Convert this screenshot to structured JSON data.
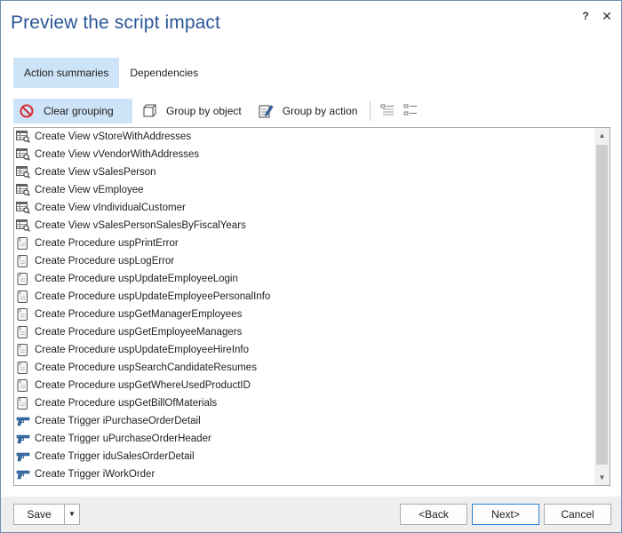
{
  "window": {
    "title": "Preview the script impact",
    "help": "?",
    "close": "✕"
  },
  "tabs": [
    {
      "label": "Action summaries",
      "active": true
    },
    {
      "label": "Dependencies",
      "active": false
    }
  ],
  "toolbar": {
    "clear_grouping": "Clear grouping",
    "group_by_object": "Group by object",
    "group_by_action": "Group by action"
  },
  "items": [
    {
      "type": "view",
      "text": "Create View vStoreWithAddresses"
    },
    {
      "type": "view",
      "text": "Create View vVendorWithAddresses"
    },
    {
      "type": "view",
      "text": "Create View vSalesPerson"
    },
    {
      "type": "view",
      "text": "Create View vEmployee"
    },
    {
      "type": "view",
      "text": "Create View vIndividualCustomer"
    },
    {
      "type": "view",
      "text": "Create View vSalesPersonSalesByFiscalYears"
    },
    {
      "type": "procedure",
      "text": "Create Procedure uspPrintError"
    },
    {
      "type": "procedure",
      "text": "Create Procedure uspLogError"
    },
    {
      "type": "procedure",
      "text": "Create Procedure uspUpdateEmployeeLogin"
    },
    {
      "type": "procedure",
      "text": "Create Procedure uspUpdateEmployeePersonalInfo"
    },
    {
      "type": "procedure",
      "text": "Create Procedure uspGetManagerEmployees"
    },
    {
      "type": "procedure",
      "text": "Create Procedure uspGetEmployeeManagers"
    },
    {
      "type": "procedure",
      "text": "Create Procedure uspUpdateEmployeeHireInfo"
    },
    {
      "type": "procedure",
      "text": "Create Procedure uspSearchCandidateResumes"
    },
    {
      "type": "procedure",
      "text": "Create Procedure uspGetWhereUsedProductID"
    },
    {
      "type": "procedure",
      "text": "Create Procedure uspGetBillOfMaterials"
    },
    {
      "type": "trigger",
      "text": "Create Trigger iPurchaseOrderDetail"
    },
    {
      "type": "trigger",
      "text": "Create Trigger uPurchaseOrderHeader"
    },
    {
      "type": "trigger",
      "text": "Create Trigger iduSalesOrderDetail"
    },
    {
      "type": "trigger",
      "text": "Create Trigger iWorkOrder"
    }
  ],
  "footer": {
    "save": "Save",
    "back": "<Back",
    "next": "Next>",
    "cancel": "Cancel"
  },
  "colors": {
    "accent": "#2b5797",
    "selected_bg": "#cde3f7",
    "trigger_icon": "#3a6ea5"
  }
}
